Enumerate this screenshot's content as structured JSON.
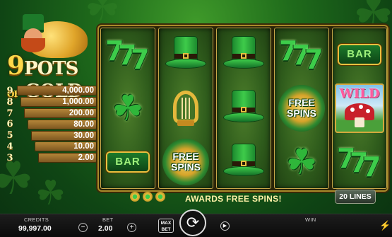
{
  "game": {
    "logo": {
      "number": "9",
      "line1": "POTS",
      "of": "OF",
      "line2": "GOLD"
    },
    "paytable": [
      {
        "pots": "9",
        "prize": "4,000.00"
      },
      {
        "pots": "8",
        "prize": "1,000.00"
      },
      {
        "pots": "7",
        "prize": "200.00"
      },
      {
        "pots": "6",
        "prize": "80.00"
      },
      {
        "pots": "5",
        "prize": "30.00"
      },
      {
        "pots": "4",
        "prize": "10.00"
      },
      {
        "pots": "3",
        "prize": "2.00"
      }
    ],
    "reels": [
      [
        "triple-seven",
        "clover",
        "bar"
      ],
      [
        "top-hat",
        "harp",
        "free-spins"
      ],
      [
        "top-hat",
        "top-hat",
        "top-hat"
      ],
      [
        "triple-seven",
        "free-spins",
        "clover"
      ],
      [
        "bar",
        "wild",
        "triple-seven"
      ]
    ],
    "symbol_text": {
      "bar": "BAR",
      "free": "FREE",
      "spins": "SPINS",
      "wild": "WILD"
    },
    "message": "AWARDS FREE SPINS!",
    "lines": "20 LINES",
    "colors": {
      "accent_gold": "#e8c040",
      "reel_green": "#2f5c1c",
      "symbol_green": "#3dcc4a"
    }
  },
  "controls": {
    "credits_label": "CREDITS",
    "credits_value": "99,997.00",
    "bet_label": "BET",
    "bet_value": "2.00",
    "minus": "−",
    "plus": "+",
    "max_bet_line1": "MAX",
    "max_bet_line2": "BET",
    "win_label": "WIN",
    "win_value": ""
  }
}
